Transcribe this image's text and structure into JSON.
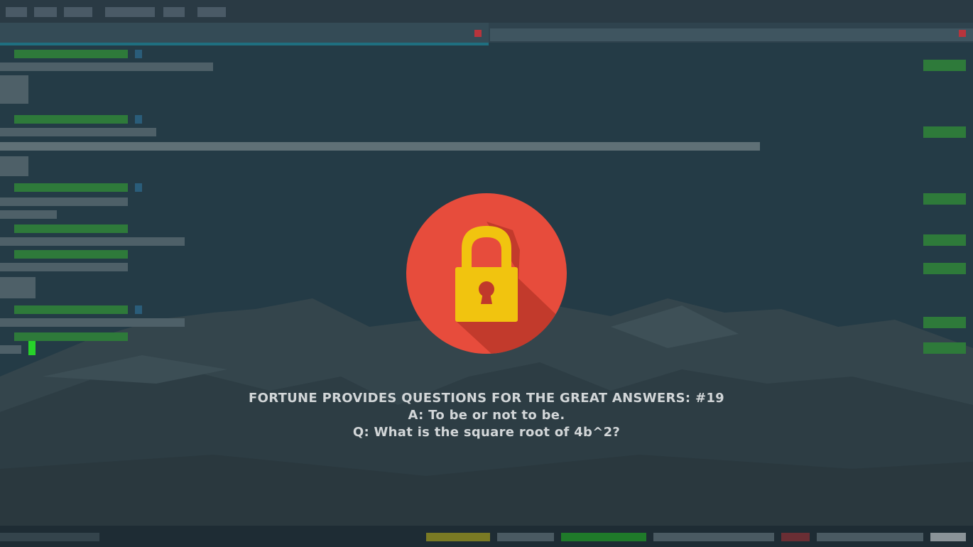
{
  "lockscreen": {
    "lock_icon": "padlock-icon",
    "colors": {
      "circle": "#e74c3c",
      "shadow": "#c0392b",
      "lock": "#f1c40f"
    }
  },
  "fortune": {
    "title": "FORTUNE PROVIDES QUESTIONS FOR THE GREAT ANSWERS: #19",
    "answer": "A:  To be or not to be.",
    "question": "Q:  What is the square root of 4b^2?"
  }
}
